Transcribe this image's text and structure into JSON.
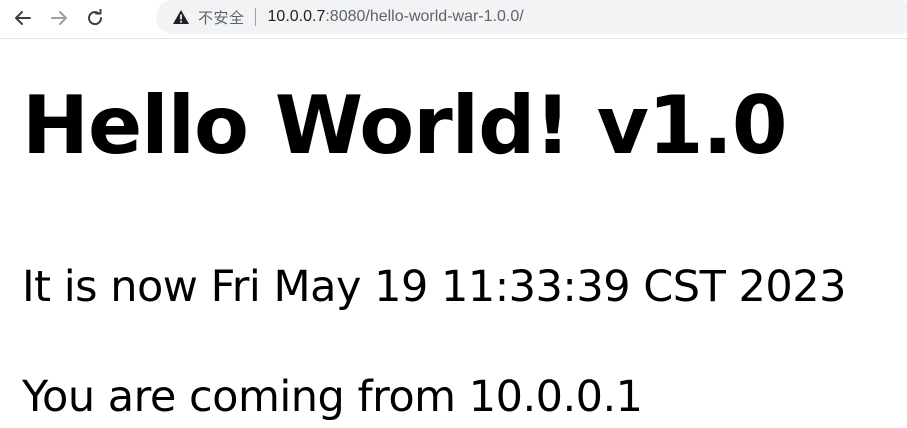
{
  "browser": {
    "back_icon": "arrow-left-icon",
    "forward_icon": "arrow-right-icon",
    "reload_icon": "reload-icon",
    "security_icon": "warning-triangle-icon",
    "security_label": "不安全",
    "url_host": "10.0.0.7",
    "url_rest": ":8080/hello-world-war-1.0.0/"
  },
  "page": {
    "heading": "Hello World! v1.0",
    "time_line": "It is now Fri May 19 11:33:39 CST 2023",
    "from_line": "You are coming from 10.0.0.1"
  }
}
